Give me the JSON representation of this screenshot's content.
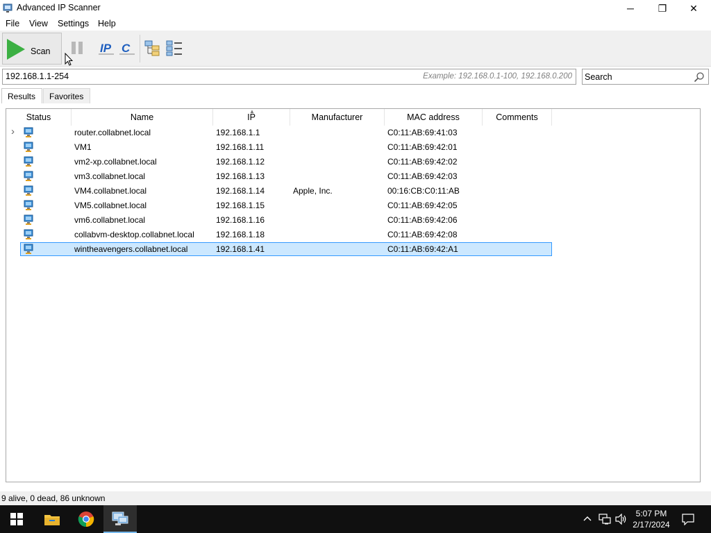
{
  "window": {
    "title": "Advanced IP Scanner",
    "minimize_glyph": "─",
    "maximize_glyph": "❐",
    "close_glyph": "✕"
  },
  "menu": [
    "File",
    "View",
    "Settings",
    "Help"
  ],
  "toolbar": {
    "scan_label": "Scan",
    "icons": [
      "play-icon",
      "pause-icon",
      "ip-icon",
      "c-icon",
      "expand-all-icon",
      "collapse-all-icon"
    ]
  },
  "address": {
    "value": "192.168.1.1-254",
    "example": "Example: 192.168.0.1-100, 192.168.0.200"
  },
  "search": {
    "text": "Search"
  },
  "tabs": [
    "Results",
    "Favorites"
  ],
  "table": {
    "columns": [
      "Status",
      "Name",
      "IP",
      "Manufacturer",
      "MAC address",
      "Comments"
    ],
    "rows": [
      {
        "name": "router.collabnet.local",
        "ip": "192.168.1.1",
        "manufacturer": "",
        "mac": "C0:11:AB:69:41:03"
      },
      {
        "name": "VM1",
        "ip": "192.168.1.11",
        "manufacturer": "",
        "mac": "C0:11:AB:69:42:01"
      },
      {
        "name": "vm2-xp.collabnet.local",
        "ip": "192.168.1.12",
        "manufacturer": "",
        "mac": "C0:11:AB:69:42:02"
      },
      {
        "name": "vm3.collabnet.local",
        "ip": "192.168.1.13",
        "manufacturer": "",
        "mac": "C0:11:AB:69:42:03"
      },
      {
        "name": "VM4.collabnet.local",
        "ip": "192.168.1.14",
        "manufacturer": "Apple, Inc.",
        "mac": "00:16:CB:C0:11:AB"
      },
      {
        "name": "VM5.collabnet.local",
        "ip": "192.168.1.15",
        "manufacturer": "",
        "mac": "C0:11:AB:69:42:05"
      },
      {
        "name": "vm6.collabnet.local",
        "ip": "192.168.1.16",
        "manufacturer": "",
        "mac": "C0:11:AB:69:42:06"
      },
      {
        "name": "collabvm-desktop.collabnet.local",
        "ip": "192.168.1.18",
        "manufacturer": "",
        "mac": "C0:11:AB:69:42:08"
      },
      {
        "name": "wintheavengers.collabnet.local",
        "ip": "192.168.1.41",
        "manufacturer": "",
        "mac": "C0:11:AB:69:42:A1"
      }
    ]
  },
  "status_bar": {
    "text": "9 alive, 0 dead, 86 unknown"
  },
  "taskbar": {
    "apps": [
      "start-icon",
      "file-explorer-icon",
      "chrome-icon",
      "ip-scanner-icon"
    ],
    "time": "5:07 PM",
    "date": "2/17/2024"
  },
  "colors": {
    "selection_fill": "#cce8ff",
    "selection_border": "#3399ff",
    "scan_green": "#3cb043",
    "taskbar": "#101010"
  }
}
